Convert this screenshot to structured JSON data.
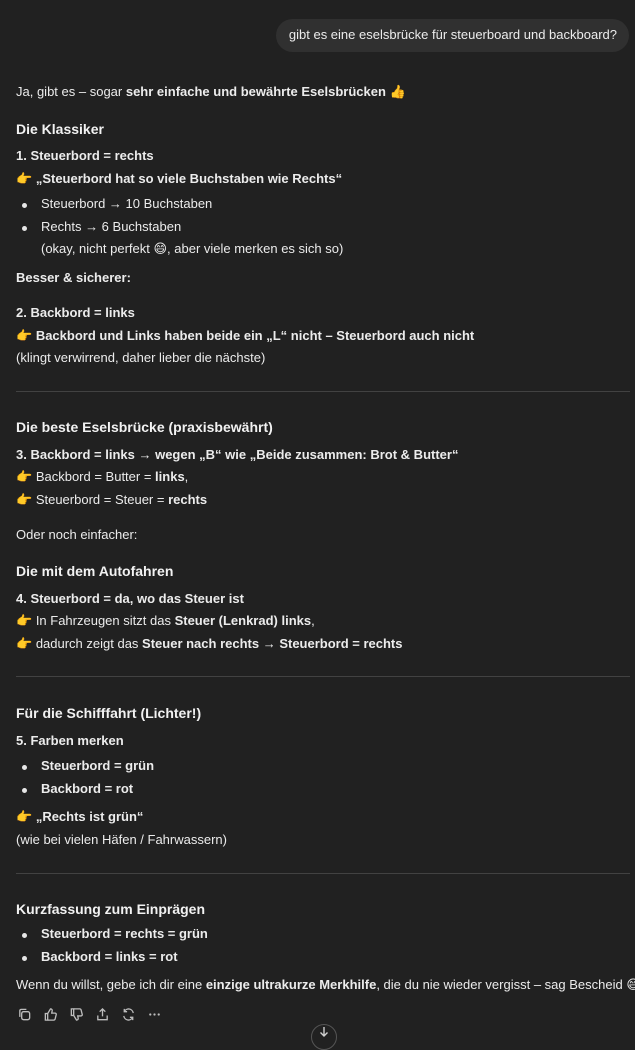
{
  "user_message": "gibt es eine eselsbrücke für steuerboard und backboard?",
  "intro": {
    "a": "Ja, gibt es – sogar ",
    "b": "sehr einfache und bewährte Eselsbrücken",
    "emoji": " 👍"
  },
  "s1": {
    "title": "Die Klassiker",
    "h1": "1. Steuerbord = rechts",
    "point": "„Steuerbord hat so viele Buchstaben wie Rechts“",
    "bullets": [
      "Steuerbord → 10 Buchstaben",
      "Rechts → 6 Buchstaben"
    ],
    "note": "(okay, nicht perfekt 😄, aber viele merken es sich so)",
    "better": "Besser & sicherer:",
    "h2": "2. Backbord = links",
    "point2": "Backbord und Links haben beide ein „L“ nicht – Steuerbord auch nicht",
    "note2": "(klingt verwirrend, daher lieber die nächste)"
  },
  "s2": {
    "title": "Die beste Eselsbrücke (praxisbewährt)",
    "h": "3. Backbord = links → wegen „B“ wie „Beide zusammen: Brot & Butter“",
    "l1a": "Backbord = Butter = ",
    "l1b": "links",
    "l1c": ",",
    "l2a": "Steuerbord = Steuer = ",
    "l2b": "rechts",
    "or": "Oder noch einfacher:"
  },
  "s3": {
    "title": "Die mit dem Autofahren",
    "h": "4. Steuerbord = da, wo das Steuer ist",
    "l1a": "In Fahrzeugen sitzt das ",
    "l1b": "Steuer (Lenkrad) links",
    "l1c": ",",
    "l2a": "dadurch zeigt das ",
    "l2b": "Steuer nach rechts → Steuerbord = rechts"
  },
  "s4": {
    "title": "Für die Schifffahrt (Lichter!)",
    "h": "5. Farben merken",
    "bullets": [
      "Steuerbord = grün",
      "Backbord = rot"
    ],
    "point": "„Rechts ist grün“",
    "note": "(wie bei vielen Häfen / Fahrwassern)"
  },
  "s5": {
    "title": "Kurzfassung zum Einprägen",
    "bullets": [
      "Steuerbord = rechts = grün",
      "Backbord = links = rot"
    ],
    "outro_a": "Wenn du willst, gebe ich dir eine ",
    "outro_b": "einzige ultrakurze Merkhilfe",
    "outro_c": ", die du nie wieder vergisst – sag Bescheid 😄"
  },
  "emoji_point": "👉",
  "icons": [
    "copy-icon",
    "thumbs-up-icon",
    "thumbs-down-icon",
    "share-icon",
    "regenerate-icon",
    "more-icon",
    "arrow-down-icon"
  ]
}
